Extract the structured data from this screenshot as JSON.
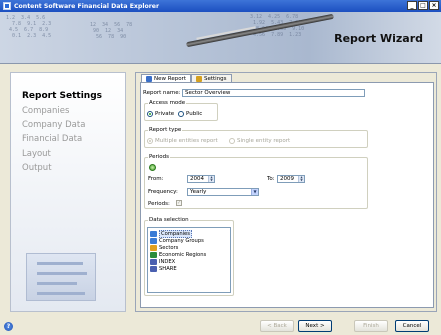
{
  "window": {
    "title": "Content Software Financial Data Explorer"
  },
  "banner": {
    "title": "Report Wizard"
  },
  "steps": [
    "Report Settings",
    "Companies",
    "Company Data",
    "Financial Data",
    "Layout",
    "Output"
  ],
  "tabs": [
    {
      "label": "New Report",
      "active": true
    },
    {
      "label": "Settings",
      "active": false
    }
  ],
  "form": {
    "report_name_label": "Report name:",
    "report_name_value": "Sector Overview",
    "access_mode": {
      "caption": "Access mode",
      "options": [
        "Private",
        "Public"
      ],
      "selected": "Private"
    },
    "report_type": {
      "caption": "Report type",
      "options": [
        "Multiple entities report",
        "Single entity report"
      ],
      "selected": "Multiple entities report"
    },
    "periods": {
      "caption": "Periods",
      "from_label": "From:",
      "from_value": "2004",
      "to_label": "To:",
      "to_value": "2009",
      "frequency_label": "Frequency:",
      "frequency_value": "Yearly",
      "periods_label": "Periods:",
      "periods_check": "✓"
    },
    "data_selection": {
      "caption": "Data selection",
      "items": [
        {
          "label": "Companies",
          "icon": "companies-icon",
          "color": "#3a7bd5"
        },
        {
          "label": "Company Groups",
          "icon": "company-groups-icon",
          "color": "#3a7bd5"
        },
        {
          "label": "Sectors",
          "icon": "sectors-icon",
          "color": "#e0a020"
        },
        {
          "label": "Economic Regions",
          "icon": "economic-regions-icon",
          "color": "#2c8c3c"
        },
        {
          "label": "INDEX",
          "icon": "index-icon",
          "color": "#4a5fb0"
        },
        {
          "label": "SHARE",
          "icon": "share-icon",
          "color": "#4a5fb0"
        }
      ],
      "selected": "Companies"
    }
  },
  "buttons": {
    "back": "< Back",
    "next": "Next >",
    "finish": "Finish",
    "cancel": "Cancel"
  },
  "window_controls": {
    "minimize": "_",
    "maximize": "□",
    "close": "×"
  }
}
